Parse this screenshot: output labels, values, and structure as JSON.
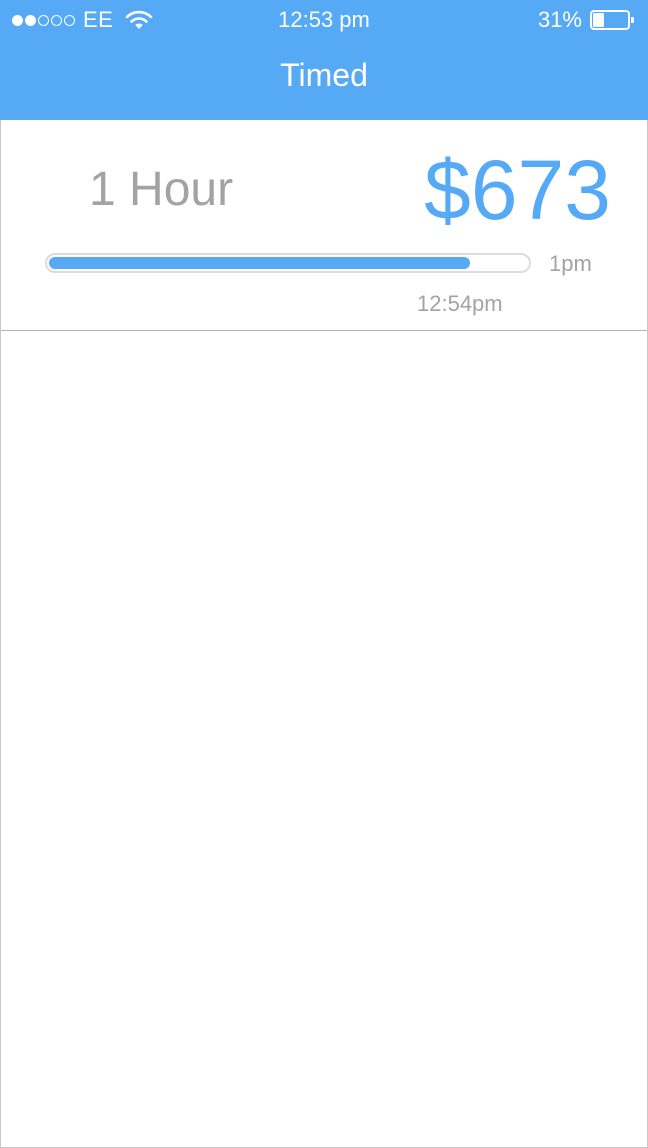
{
  "status_bar": {
    "signal_strength": 2,
    "signal_max": 5,
    "carrier": "EE",
    "time": "12:53 pm",
    "battery_percent": "31%",
    "battery_level": 0.31,
    "wifi_icon": "wifi-icon",
    "battery_icon": "battery-icon"
  },
  "header": {
    "title": "Timed",
    "background_color": "#55a9f5"
  },
  "timer_card": {
    "duration": "1 Hour",
    "price": "$673",
    "progress": 0.88,
    "end_time": "1pm",
    "current_time": "12:54pm",
    "accent_color": "#55a9f5",
    "text_color": "#a3a3a3"
  }
}
